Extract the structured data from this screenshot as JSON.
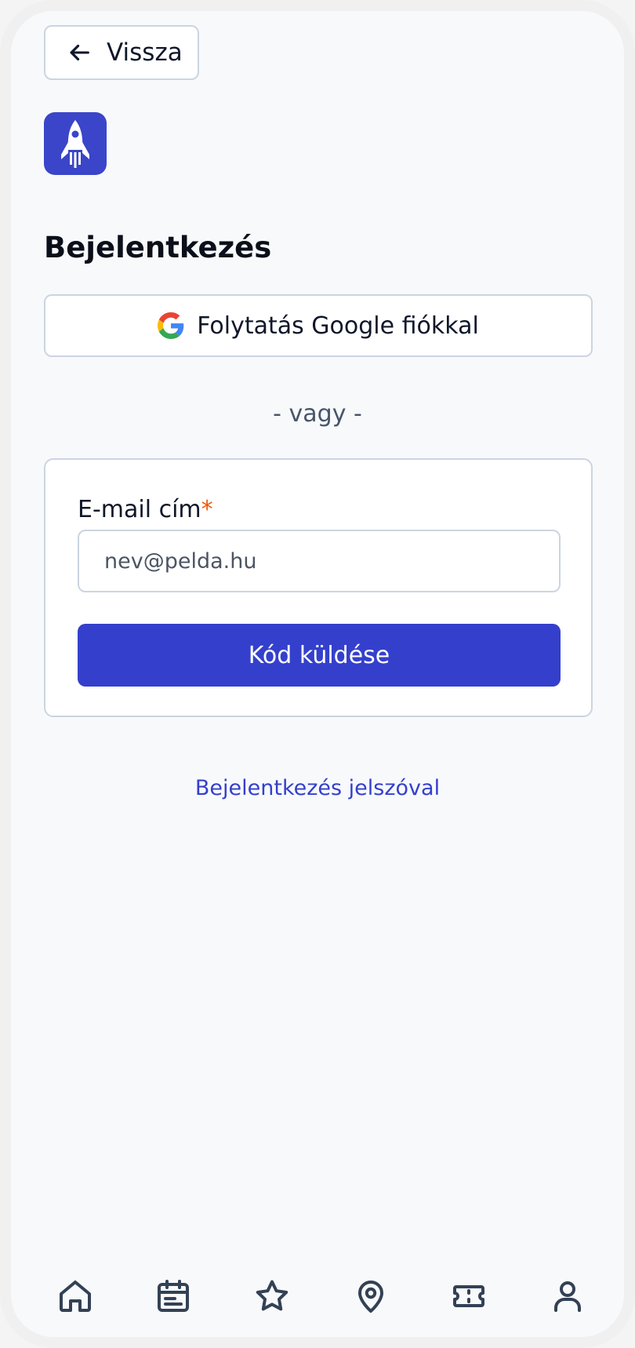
{
  "header": {
    "back_label": "Vissza"
  },
  "app": {
    "logo_icon": "rocket-icon",
    "brand_color": "#3a45c9"
  },
  "page": {
    "title": "Bejelentkezés"
  },
  "google": {
    "label": "Folytatás Google fiókkal",
    "icon": "google-icon"
  },
  "divider": "- vagy -",
  "form": {
    "email_label": "E-mail cím",
    "required_mark": "*",
    "email_placeholder": "nev@pelda.hu",
    "email_value": "",
    "submit_label": "Kód küldése"
  },
  "password_link": "Bejelentkezés jelszóval",
  "bottom_nav": [
    {
      "icon": "home-icon"
    },
    {
      "icon": "calendar-icon"
    },
    {
      "icon": "star-icon"
    },
    {
      "icon": "map-pin-icon"
    },
    {
      "icon": "ticket-icon"
    },
    {
      "icon": "user-icon"
    }
  ],
  "colors": {
    "accent": "#3440cc",
    "required": "#ea580c",
    "background": "#f8f9fb"
  }
}
